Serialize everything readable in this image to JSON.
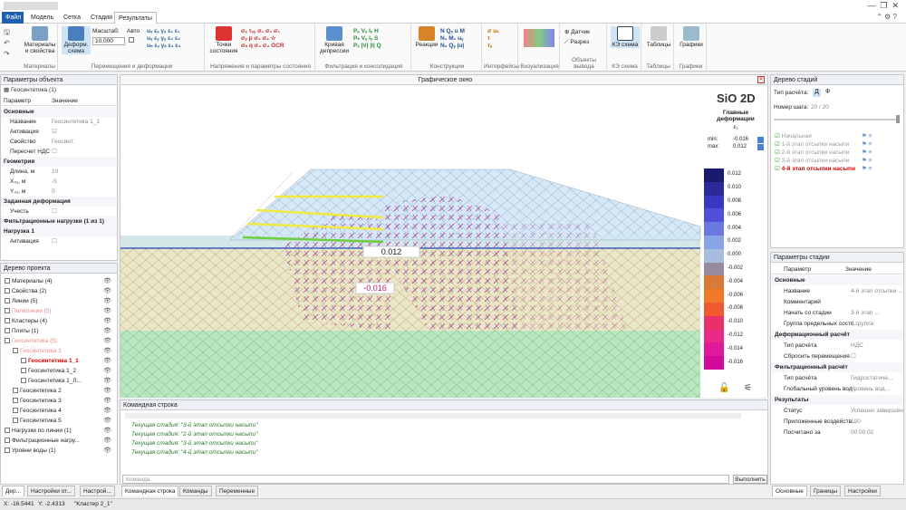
{
  "menu": {
    "tabs": [
      "Файл",
      "Модель",
      "Сетка",
      "Стадии",
      "Результаты"
    ]
  },
  "ribbon": {
    "groups": [
      "Материалы",
      "Перемещения и деформации",
      "Напряжения и параметры состояния",
      "Фильтрация и консолидация",
      "Конструкции",
      "Интерфейсы",
      "Визуализация",
      "Объекты вывода",
      "КЭ схема",
      "Таблицы",
      "Графики"
    ],
    "materials_btn": "Материалы и свойства",
    "deform_btn": "Деформ. схема",
    "scale_label": "Масштаб:",
    "scale_value": "10,000",
    "auto_label": "Авто",
    "points_btn": "Точки состояния",
    "depression_btn": "Кривая депрессии",
    "reactions_btn": "Реакции",
    "sensor_btn": "Датчик",
    "section_btn": "Разрез",
    "ke_btn": "КЭ схема",
    "tables_btn": "Таблицы",
    "graphs_btn": "Графики"
  },
  "left": {
    "params_title": "Параметры объекта",
    "object_name": "Геосинтетика (1)",
    "col_param": "Параметр",
    "col_value": "Значение",
    "rows": [
      {
        "k": "Основные",
        "section": true
      },
      {
        "k": "Название",
        "v": "Геосинтетика 1_1"
      },
      {
        "k": "Активация",
        "v": "☑"
      },
      {
        "k": "Свойство",
        "v": "Геосинт."
      },
      {
        "k": "Пересчет НДС",
        "v": "☐"
      },
      {
        "k": "Геометрия",
        "section": true
      },
      {
        "k": "Длина, м",
        "v": "10"
      },
      {
        "k": "X₀₁, м",
        "v": "-5"
      },
      {
        "k": "Y₀₁, м",
        "v": "0"
      },
      {
        "k": "Заданная деформация",
        "section": true
      },
      {
        "k": "Учесть",
        "v": "☐"
      },
      {
        "k": "Фильтрационные нагрузки (1 из 1)",
        "section": true
      },
      {
        "k": "Нагрузка 1",
        "section": true
      },
      {
        "k": "Активация",
        "v": "☐"
      }
    ],
    "tree_title": "Дерево проекта",
    "tree": [
      {
        "t": "Материалы (4)",
        "d": 0,
        "c": ""
      },
      {
        "t": "Свойства (2)",
        "d": 0,
        "c": ""
      },
      {
        "t": "Линии (5)",
        "d": 0,
        "c": ""
      },
      {
        "t": "Полилинии (5)",
        "d": 0,
        "c": "#e88"
      },
      {
        "t": "Кластеры (4)",
        "d": 0,
        "c": ""
      },
      {
        "t": "Плиты (1)",
        "d": 0,
        "c": ""
      },
      {
        "t": "Геосинтетика (5)",
        "d": 0,
        "c": "#e88"
      },
      {
        "t": "Геосинтетика 1",
        "d": 1,
        "c": "#e88"
      },
      {
        "t": "Геосинтетика 1_1",
        "d": 2,
        "c": "#d00",
        "b": true
      },
      {
        "t": "Геосинтетика 1_2",
        "d": 2,
        "c": ""
      },
      {
        "t": "Геосинтетика 1_Л...",
        "d": 2,
        "c": ""
      },
      {
        "t": "Геосинтетика 2",
        "d": 1,
        "c": ""
      },
      {
        "t": "Геосинтетика 3",
        "d": 1,
        "c": ""
      },
      {
        "t": "Геосинтетика 4",
        "d": 1,
        "c": ""
      },
      {
        "t": "Геосинтетика 5",
        "d": 1,
        "c": ""
      },
      {
        "t": "Нагрузки по линии (1)",
        "d": 0,
        "c": ""
      },
      {
        "t": "Фильтрационные нагру...",
        "d": 0,
        "c": ""
      },
      {
        "t": "Уровни воды (1)",
        "d": 0,
        "c": ""
      }
    ],
    "bottom_tabs": [
      "Дер...",
      "Настройки от...",
      "Настрой..."
    ]
  },
  "center": {
    "title": "Графическое окно",
    "logo": "SiO 2D",
    "legend_title": "Главные деформации",
    "legend_sub": "ε₁",
    "min_label": "min:",
    "min_value": "-0.016",
    "max_label": "max:",
    "max_value": "0.012",
    "ticks": [
      "0.012",
      "0.010",
      "0.008",
      "0.006",
      "0.004",
      "0.002",
      "0.000",
      "-0.002",
      "-0.004",
      "-0.006",
      "-0.008",
      "-0.010",
      "-0.012",
      "-0.014",
      "-0.016"
    ],
    "label_max": "0.012",
    "label_min": "-0.016",
    "cmd_title": "Командная строка",
    "log": [
      "Текущая стадия: \"3-й этап отсыпки насыпи\"",
      "Текущая стадия: \"2-й этап отсыпки насыпи\"",
      "Текущая стадия: \"3-й этап отсыпки насыпи\"",
      "Текущая стадия: \"4-й этап отсыпки насыпи\""
    ],
    "cmd_placeholder": "Команда",
    "run_btn": "Выполнить",
    "cmd_tabs": [
      "Командная строка",
      "Команды",
      "Переменные"
    ]
  },
  "right": {
    "tree_title": "Дерево стадий",
    "calc_type_label": "Тип расчёта:",
    "step_label": "Номер шага:",
    "step_value": "20 / 20",
    "stages": [
      "Начальная",
      "1-й этап отсыпки насыпи",
      "2-й этап отсыпки насыпи",
      "3-й этап отсыпки насыпи",
      "4-й этап отсыпки насыпи"
    ],
    "params_title": "Параметры стадии",
    "col_param": "Параметр",
    "col_value": "Значение",
    "rows": [
      {
        "k": "Основные",
        "section": true
      },
      {
        "k": "Название",
        "v": "4-й этап отсыпки ..."
      },
      {
        "k": "Комментарий",
        "v": ""
      },
      {
        "k": "Начать со стадии",
        "v": "3-й этап ..."
      },
      {
        "k": "Группа предельных состо...",
        "v": "II группа"
      },
      {
        "k": "Деформационный расчёт",
        "section": true
      },
      {
        "k": "Тип расчёта",
        "v": "НДС"
      },
      {
        "k": "Сбросить перемещения",
        "v": "☐"
      },
      {
        "k": "Фильтрационный расчёт",
        "section": true
      },
      {
        "k": "Тип расчёта",
        "v": "Гидростатиче..."
      },
      {
        "k": "Глобальный уровень вод...",
        "v": "Уровень вод..."
      },
      {
        "k": "Результаты",
        "section": true
      },
      {
        "k": "Статус",
        "v": "Успешно завершён"
      },
      {
        "k": "Приложенные воздейств...",
        "v": "100"
      },
      {
        "k": "Посчитано за",
        "v": "00:00:02"
      }
    ],
    "bottom_tabs": [
      "Основные",
      "Границы",
      "Настройки"
    ]
  },
  "status": {
    "x": "X: -16.5441",
    "y": "Y: -2.4313",
    "cluster": "\"Кластер 2_1\""
  }
}
